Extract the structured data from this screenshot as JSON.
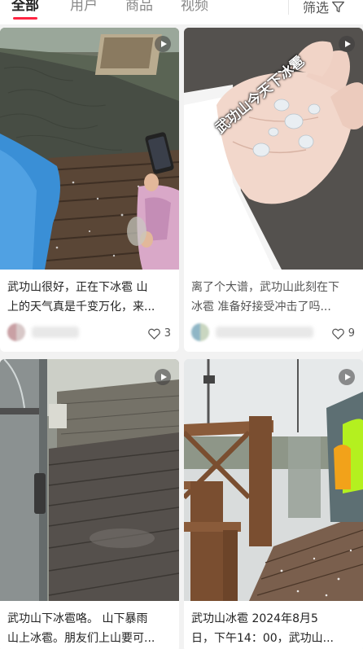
{
  "tabs": {
    "all": "全部",
    "users": "用户",
    "goods": "商品",
    "video": "视频",
    "filter": "筛选"
  },
  "cards": [
    {
      "title_line1": "武功山很好，正在下冰雹 山",
      "title_line2": "上的天气真是千变万化，来...",
      "likes": "3"
    },
    {
      "title_line1": "离了个大谱，武功山此刻在下",
      "title_line2": "冰雹 准备好接受冲击了吗...",
      "likes": "9",
      "overlay": "武功山今天下冰雹"
    },
    {
      "title_line1": "武功山下冰雹咯。 山下暴雨",
      "title_line2": "山上冰雹。朋友们上山要可..."
    },
    {
      "title_line1": "武功山冰雹 2024年8月5",
      "title_line2": "日，下午14：00，武功山..."
    }
  ],
  "colors": {
    "accent": "#ff2442",
    "background": "#f2f2f2"
  }
}
